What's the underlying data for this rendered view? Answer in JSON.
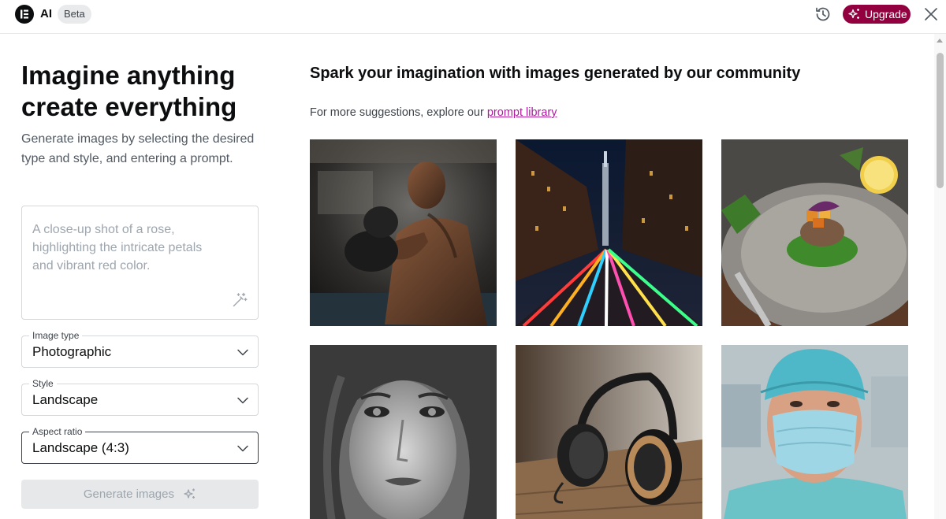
{
  "header": {
    "logo_icon": "elementor-logo-icon",
    "app_name": "AI",
    "badge": "Beta",
    "history_icon": "history-icon",
    "upgrade_label": "Upgrade",
    "upgrade_icon": "sparkles-icon",
    "close_icon": "close-icon",
    "brand_color": "#93003f"
  },
  "left": {
    "headline_line1": "Imagine anything",
    "headline_line2": "create everything",
    "description": "Generate images by selecting the desired type and style, and entering a prompt.",
    "prompt_placeholder": "A close-up shot of a rose, highlighting the intricate petals and vibrant red color.",
    "prompt_value": "",
    "enhance_icon": "magic-wand-icon",
    "image_type": {
      "label": "Image type",
      "value": "Photographic"
    },
    "style": {
      "label": "Style",
      "value": "Landscape"
    },
    "aspect_ratio": {
      "label": "Aspect ratio",
      "value": "Landscape (4:3)"
    },
    "generate_label": "Generate images",
    "generate_icon": "sparkles-icon"
  },
  "right": {
    "title": "Spark your imagination with images generated by our community",
    "suggest_text": "For more suggestions, explore our ",
    "suggest_link": "prompt library",
    "link_color": "#b01b9f",
    "images": [
      {
        "name": "boxer-image"
      },
      {
        "name": "city-street-light-trails-image"
      },
      {
        "name": "plated-food-image"
      },
      {
        "name": "woman-portrait-image"
      },
      {
        "name": "headphones-image"
      },
      {
        "name": "surgeon-portrait-image"
      }
    ]
  }
}
